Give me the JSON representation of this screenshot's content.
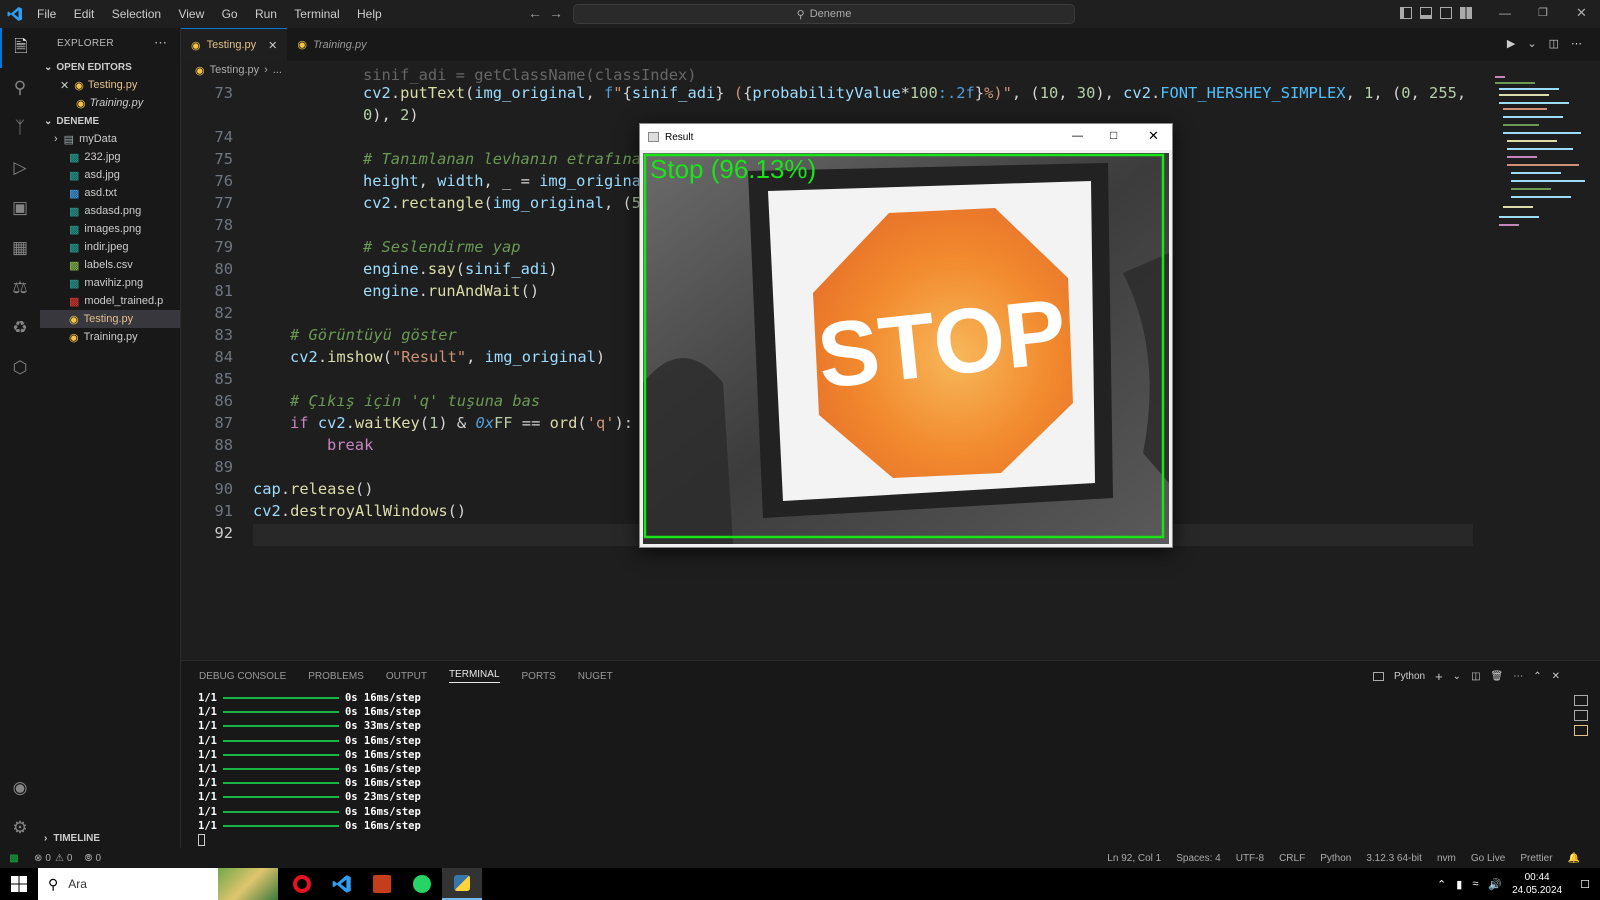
{
  "menu": [
    "File",
    "Edit",
    "Selection",
    "View",
    "Go",
    "Run",
    "Terminal",
    "Help"
  ],
  "search": {
    "text": "Deneme"
  },
  "explorer": {
    "title": "EXPLORER",
    "open_editors_label": "OPEN EDITORS",
    "open_editors": [
      "Testing.py",
      "Training.py"
    ],
    "folder_label": "DENEME",
    "files": [
      "myData",
      "232.jpg",
      "asd.jpg",
      "asd.txt",
      "asdasd.png",
      "images.png",
      "indir.jpeg",
      "labels.csv",
      "mavihiz.png",
      "model_trained.p",
      "Testing.py",
      "Training.py"
    ],
    "timeline_label": "TIMELINE"
  },
  "tabs": [
    {
      "label": "Testing.py"
    },
    {
      "label": "Training.py"
    }
  ],
  "breadcrumb": {
    "file": "Testing.py",
    "more": "..."
  },
  "code": {
    "line_numbers": [
      "73",
      "",
      "74",
      "75",
      "76",
      "77",
      "78",
      "79",
      "80",
      "81",
      "82",
      "83",
      "84",
      "85",
      "86",
      "87",
      "88",
      "89",
      "90",
      "91",
      "92"
    ],
    "comment_75": "# Tanımlanan levhanın etrafına",
    "comment_79": "# Seslendirme yap",
    "comment_83": "# Görüntüyü göster",
    "comment_86": "# Çıkış için 'q' tuşuna bas"
  },
  "panel": {
    "tabs": [
      "DEBUG CONSOLE",
      "PROBLEMS",
      "OUTPUT",
      "TERMINAL",
      "PORTS",
      "NUGET"
    ],
    "active_tab": "TERMINAL",
    "shell": "Python",
    "lines": [
      {
        "step": "1/1",
        "time": "0s 16ms/step"
      },
      {
        "step": "1/1",
        "time": "0s 16ms/step"
      },
      {
        "step": "1/1",
        "time": "0s 33ms/step"
      },
      {
        "step": "1/1",
        "time": "0s 16ms/step"
      },
      {
        "step": "1/1",
        "time": "0s 16ms/step"
      },
      {
        "step": "1/1",
        "time": "0s 16ms/step"
      },
      {
        "step": "1/1",
        "time": "0s 16ms/step"
      },
      {
        "step": "1/1",
        "time": "0s 23ms/step"
      },
      {
        "step": "1/1",
        "time": "0s 16ms/step"
      },
      {
        "step": "1/1",
        "time": "0s 16ms/step"
      }
    ]
  },
  "result_window": {
    "title": "Result",
    "overlay_text": "Stop (96.13%)",
    "sign_text": "STOP"
  },
  "status": {
    "errors": "0",
    "warnings": "0",
    "ports": "0",
    "position": "Ln 92, Col 1",
    "spaces": "Spaces: 4",
    "encoding": "UTF-8",
    "eol": "CRLF",
    "language": "Python",
    "interpreter": "3.12.3 64-bit",
    "nvm": "nvm",
    "golive": "Go Live",
    "prettier": "Prettier"
  },
  "taskbar": {
    "search_placeholder": "Ara",
    "time": "00:44",
    "date": "24.05.2024"
  },
  "colors": {
    "accent": "#0078d4",
    "detection": "#18e418",
    "progress": "#18b544",
    "stop_sign": "#f08a2a"
  }
}
